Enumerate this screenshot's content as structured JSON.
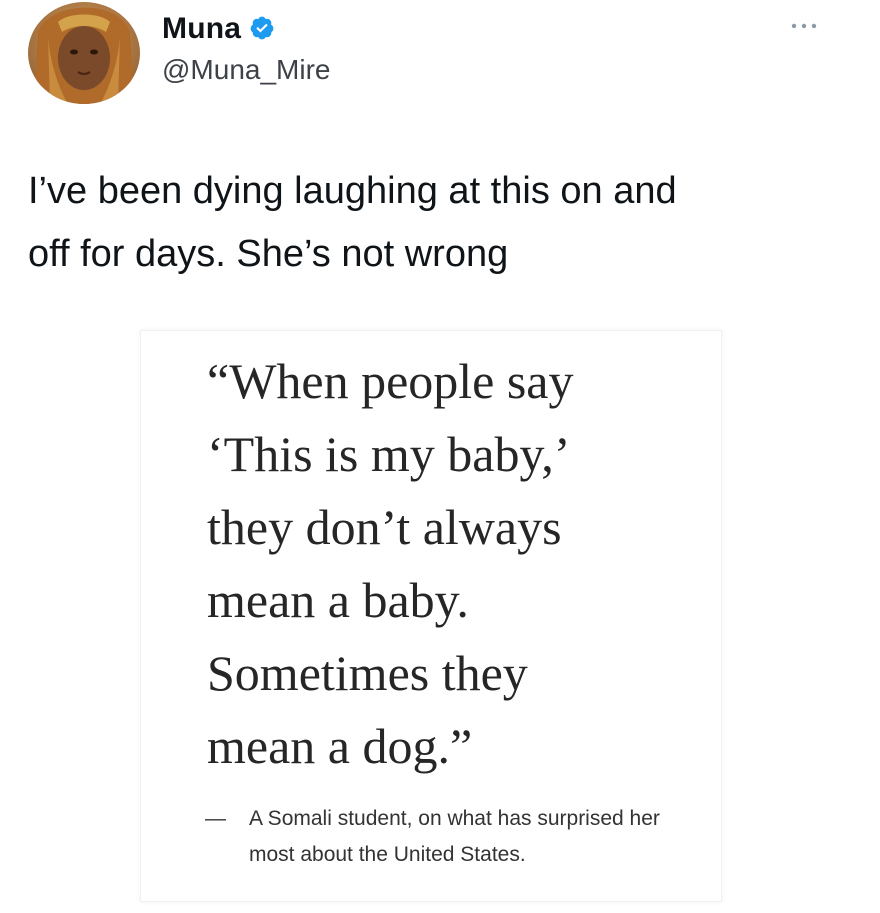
{
  "tweet": {
    "display_name": "Muna",
    "handle": "@Muna_Mire",
    "verified": true,
    "verified_icon": "verified-badge-icon",
    "more_icon": "more-options-icon",
    "text": "I’ve been dying laughing at this on and\noff for days. She’s not wrong"
  },
  "quote_card": {
    "quote": "“When people say\n‘This is my baby,’\nthey don’t always\nmean a baby.\nSometimes they\nmean a dog.”",
    "attribution_dash": "—",
    "attribution": "A Somali student, on what has surprised her most about the United States."
  },
  "colors": {
    "verified_blue": "#1d9bf0",
    "text_primary": "#0f1419",
    "text_secondary": "#3c4248"
  }
}
